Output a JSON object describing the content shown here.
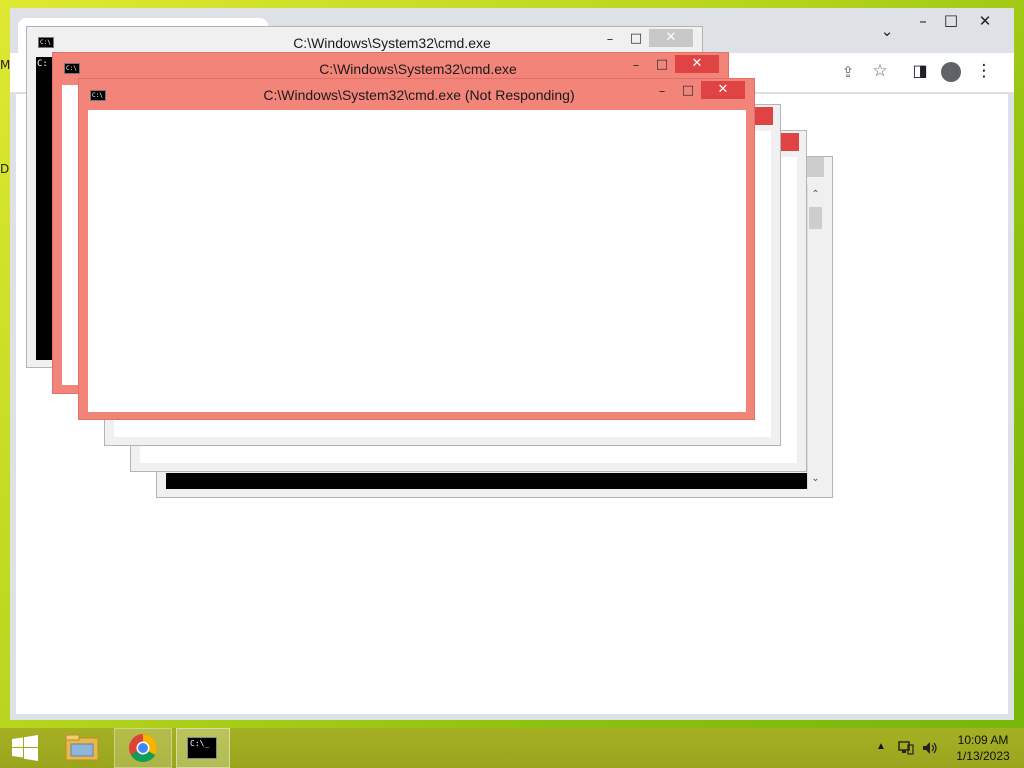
{
  "windows": {
    "back": {
      "title": "C:\\Windows\\System32\\cmd.exe",
      "console_prompt": "C:"
    },
    "middle": {
      "title": "C:\\Windows\\System32\\cmd.exe"
    },
    "front": {
      "title": "C:\\Windows\\System32\\cmd.exe (Not Responding)"
    }
  },
  "caption_buttons": {
    "minimize": "–",
    "maximize": "□",
    "close": "✕"
  },
  "browser": {
    "minimize": "–",
    "maximize": "□",
    "close": "✕",
    "chevron": "⌄",
    "share": "⇪",
    "star": "☆",
    "sidebar": "◨",
    "menu": "⋮"
  },
  "desktop_icons": {
    "left_top": "M",
    "left_mid": "D"
  },
  "taskbar": {
    "items": [
      "start",
      "file-explorer",
      "chrome",
      "cmd"
    ]
  },
  "clock": {
    "time": "10:09 AM",
    "date": "1/13/2023"
  },
  "colors": {
    "not_responding": "#f3847a",
    "close_red": "#e04343",
    "taskbar": "#a0aa21"
  }
}
